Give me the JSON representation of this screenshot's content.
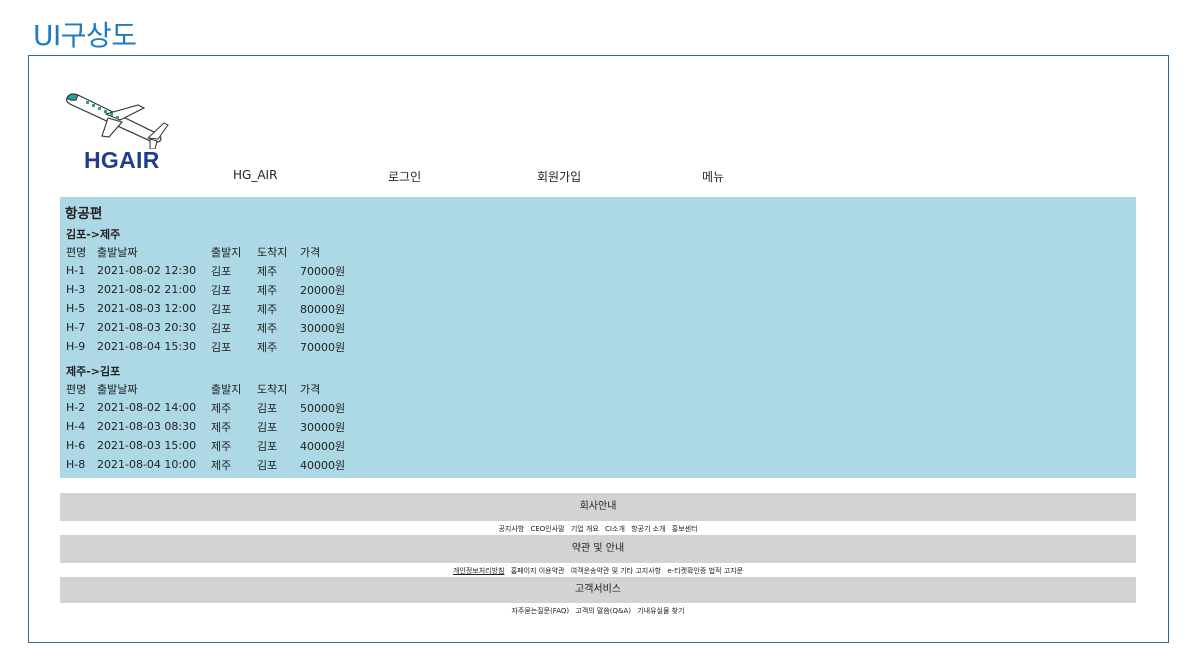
{
  "page_heading": "UI구상도",
  "logo": {
    "text": "HGAIR"
  },
  "nav": {
    "home": "HG_AIR",
    "login": "로그인",
    "signup": "회원가입",
    "menu": "메뉴"
  },
  "flights": {
    "title": "항공편",
    "routes": [
      {
        "title": "김포->제주",
        "headers": [
          "편명",
          "출발날짜",
          "출발지",
          "도착지",
          "가격"
        ],
        "rows": [
          [
            "H-1",
            "2021-08-02 12:30",
            "김포",
            "제주",
            "70000원"
          ],
          [
            "H-3",
            "2021-08-02 21:00",
            "김포",
            "제주",
            "20000원"
          ],
          [
            "H-5",
            "2021-08-03 12:00",
            "김포",
            "제주",
            "80000원"
          ],
          [
            "H-7",
            "2021-08-03 20:30",
            "김포",
            "제주",
            "30000원"
          ],
          [
            "H-9",
            "2021-08-04 15:30",
            "김포",
            "제주",
            "70000원"
          ]
        ]
      },
      {
        "title": "제주->김포",
        "headers": [
          "편명",
          "출발날짜",
          "출발지",
          "도착지",
          "가격"
        ],
        "rows": [
          [
            "H-2",
            "2021-08-02 14:00",
            "제주",
            "김포",
            "50000원"
          ],
          [
            "H-4",
            "2021-08-03 08:30",
            "제주",
            "김포",
            "30000원"
          ],
          [
            "H-6",
            "2021-08-03 15:00",
            "제주",
            "김포",
            "40000원"
          ],
          [
            "H-8",
            "2021-08-04 10:00",
            "제주",
            "김포",
            "40000원"
          ]
        ]
      }
    ]
  },
  "footer": {
    "company": {
      "title": "회사안내",
      "links": [
        "공지사항",
        "CEO인사말",
        "기업 개요",
        "CI소개",
        "항공기 소개",
        "홍보센터"
      ]
    },
    "terms": {
      "title": "약관 및 안내",
      "links": [
        "개인정보처리방침",
        "홈페이지 이용약관",
        "여객운송약관 및 기타 고지사항",
        "e-티켓확인증 법적 고지문"
      ]
    },
    "service": {
      "title": "고객서비스",
      "links": [
        "자주묻는질문(FAQ)",
        "고객의 말씀(Q&A)",
        "기내유실물 찾기"
      ]
    }
  },
  "colors": {
    "heading": "#1f7bc1",
    "frame_border": "#2e6aa0",
    "flight_background": "#add8e6",
    "footer_band": "#d3d3d3",
    "logo_text": "#1d3d8f",
    "plane_accent": "#2aa198"
  }
}
